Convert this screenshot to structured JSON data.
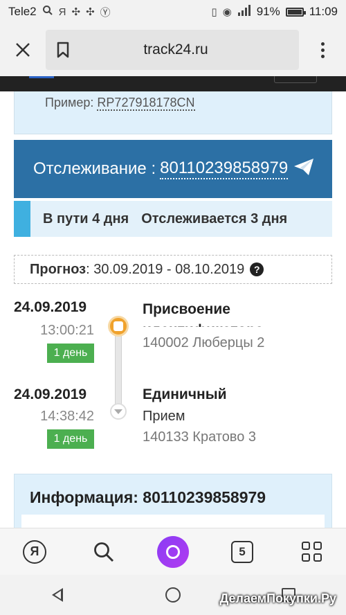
{
  "statusbar": {
    "carrier": "Tele2",
    "battery": "91%",
    "battery_level": 0.91,
    "time": "11:09"
  },
  "browser": {
    "url": "track24.ru"
  },
  "example": {
    "prefix": "Пример:",
    "number": "RP727918178CN"
  },
  "tracking": {
    "label": "Отслеживание :",
    "number": "80110239858979"
  },
  "status": {
    "in_transit": "В пути 4 дня",
    "tracked": "Отслеживается 3 дня"
  },
  "forecast": {
    "label": "Прогноз",
    "range": ": 30.09.2019 - 08.10.2019",
    "help_glyph": "?"
  },
  "events": [
    {
      "date": "24.09.2019",
      "time": "13:00:21",
      "badge": "1 день",
      "title": "Присвоение идентификатора",
      "sub": "",
      "location": "140002 Люберцы 2"
    },
    {
      "date": "24.09.2019",
      "time": "14:38:42",
      "badge": "1 день",
      "title": "Единичный",
      "sub": "Прием",
      "location": "140133 Кратово 3"
    }
  ],
  "info": {
    "title": "Информация: 80110239858979"
  },
  "toolbar": {
    "yandex_glyph": "Я",
    "tabs_count": "5"
  },
  "watermark": "ДелаемПокупки.Ру"
}
